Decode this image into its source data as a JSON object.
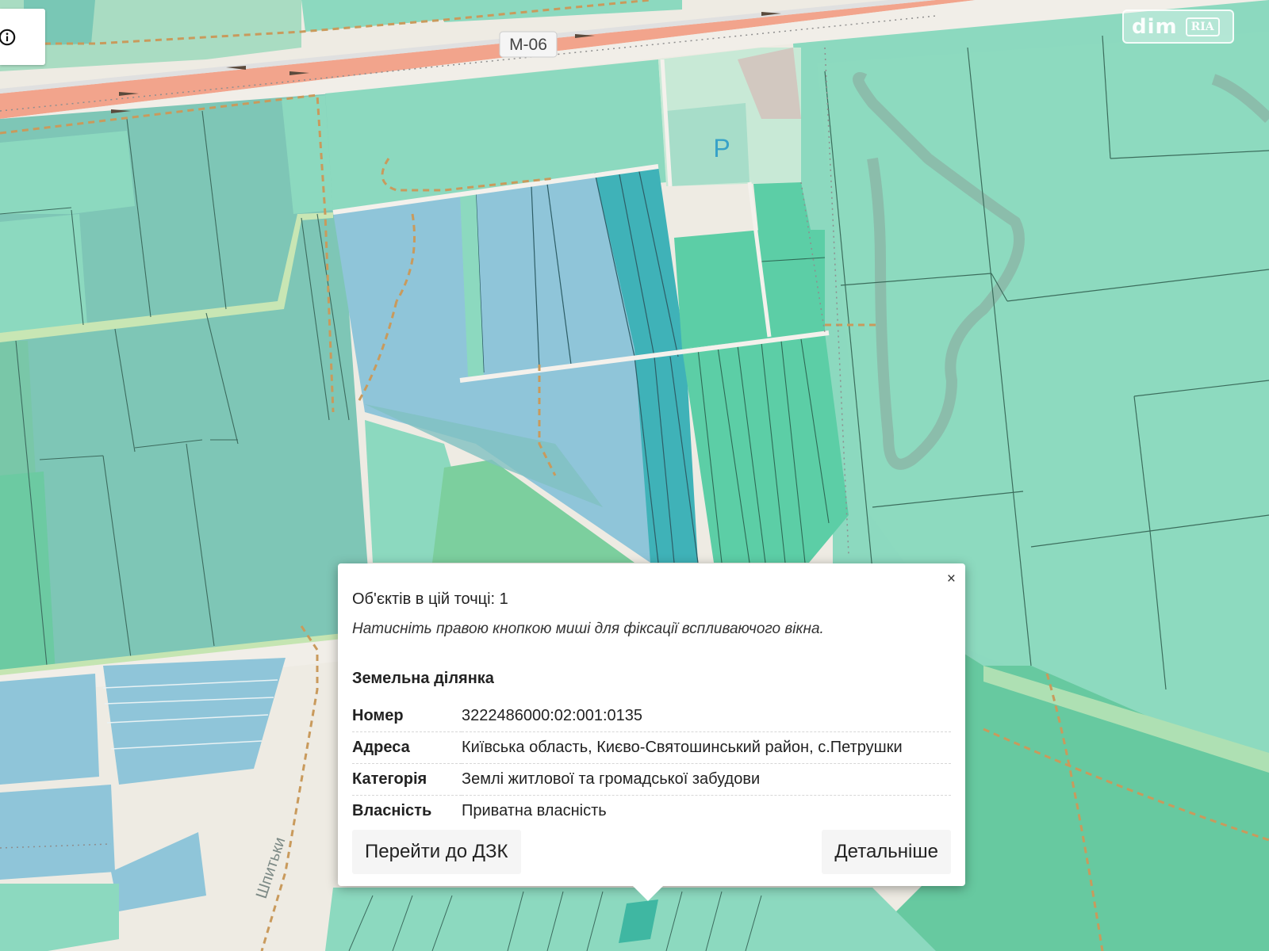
{
  "map": {
    "road_label": "M-06",
    "street_label_bottom": "Шпитьки",
    "parking_label": "P",
    "logo_dim": "dim",
    "logo_ria": "RIA",
    "colors": {
      "background": "#eeebe3",
      "parcel_green": "#8cd9bf",
      "parcel_teal": "#7cc6b5",
      "parcel_blue": "#8fc5d9",
      "parcel_dark_teal": "#3fb2b8",
      "residential_green": "#5ccea6",
      "forest": "#8ad0a0",
      "road_main": "#f2a48c",
      "path": "#c99a5c"
    }
  },
  "info_button": {
    "icon": "info-circle-icon"
  },
  "popup": {
    "objects_count": "Об'єктів в цій точці: 1",
    "hint": "Натисніть правою кнопкою миші для фіксації вспливаючого вікна.",
    "section_title": "Земельна ділянка",
    "rows": [
      {
        "label": "Номер",
        "value": "3222486000:02:001:0135"
      },
      {
        "label": "Адреса",
        "value": "Київська область, Києво-Святошинський район, с.Петрушки"
      },
      {
        "label": "Категорія",
        "value": "Землі житлової та громадської забудови"
      },
      {
        "label": "Власність",
        "value": "Приватна власність"
      }
    ],
    "buttons": {
      "dzk": "Перейти до ДЗК",
      "details": "Детальніше"
    },
    "close_label": "×"
  }
}
